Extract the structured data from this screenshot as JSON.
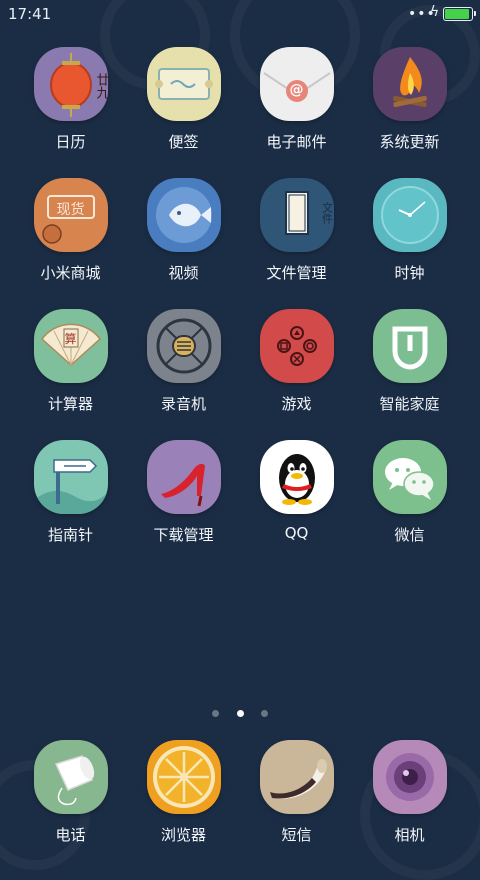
{
  "status_bar": {
    "time": "17:41",
    "more_dots": "•••",
    "charging_symbol": "ϟ",
    "battery_level_percent": 85,
    "battery_color": "#45d24a"
  },
  "apps": [
    {
      "label": "日历",
      "icon": "calendar-lantern-icon",
      "color": "#8b7ab0",
      "badge_text": "廿九"
    },
    {
      "label": "便签",
      "icon": "notes-scroll-icon",
      "color": "#e6e0ad"
    },
    {
      "label": "电子邮件",
      "icon": "email-envelope-icon",
      "color": "#eeeeee",
      "badge_text": "@"
    },
    {
      "label": "系统更新",
      "icon": "campfire-icon",
      "color": "#5a4068"
    },
    {
      "label": "小米商城",
      "icon": "mi-store-icon",
      "color": "#d7844f",
      "badge_text": "现货"
    },
    {
      "label": "视频",
      "icon": "video-fish-icon",
      "color": "#4a7cc0"
    },
    {
      "label": "文件管理",
      "icon": "file-manager-icon",
      "color": "#2f5577",
      "badge_text": "文件"
    },
    {
      "label": "时钟",
      "icon": "clock-icon",
      "color": "#5ab8c0"
    },
    {
      "label": "计算器",
      "icon": "calculator-fan-icon",
      "color": "#7fbf9b",
      "badge_text": "算"
    },
    {
      "label": "录音机",
      "icon": "recorder-microphone-icon",
      "color": "#7d838c"
    },
    {
      "label": "游戏",
      "icon": "gamepad-icon",
      "color": "#d24a4a"
    },
    {
      "label": "智能家庭",
      "icon": "smart-home-icon",
      "color": "#7dbd92"
    },
    {
      "label": "指南针",
      "icon": "compass-signpost-icon",
      "color": "#7fc7b3"
    },
    {
      "label": "下载管理",
      "icon": "download-high-heel-icon",
      "color": "#9a82b8"
    },
    {
      "label": "QQ",
      "icon": "qq-penguin-icon",
      "color": "#ffffff"
    },
    {
      "label": "微信",
      "icon": "wechat-icon",
      "color": "#7ec08d"
    }
  ],
  "dock": [
    {
      "label": "电话",
      "icon": "phone-cup-icon",
      "color": "#87b78f"
    },
    {
      "label": "浏览器",
      "icon": "browser-orange-icon",
      "color": "#f0a020"
    },
    {
      "label": "短信",
      "icon": "sms-horn-icon",
      "color": "#cab79a"
    },
    {
      "label": "相机",
      "icon": "camera-lens-icon",
      "color": "#b58ab8"
    }
  ],
  "page_indicator": {
    "pages": 3,
    "current_page": 2
  }
}
